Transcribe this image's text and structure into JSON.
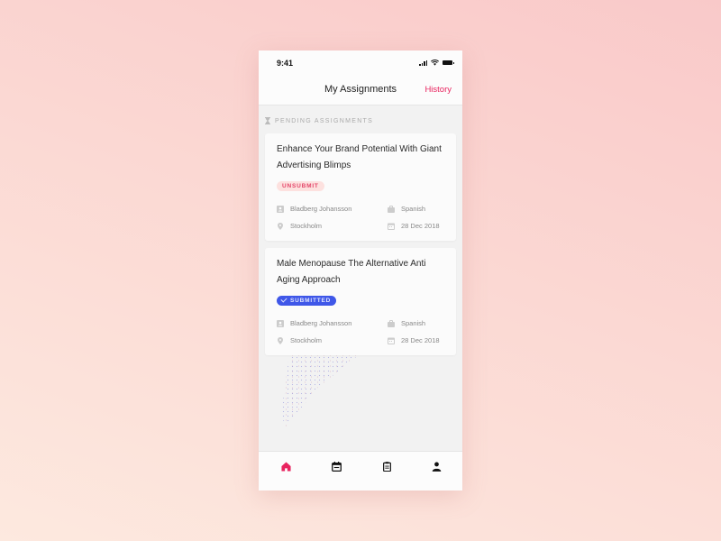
{
  "status_bar": {
    "time": "9:41"
  },
  "header": {
    "title": "My Assignments",
    "history_label": "History"
  },
  "colors": {
    "accent": "#e8245f",
    "submitted": "#3f57e8",
    "unsubmit_bg": "#fde1df",
    "unsubmit_text": "#e4466a"
  },
  "section": {
    "label": "PENDING ASSIGNMENTS",
    "icon": "hourglass-icon"
  },
  "assignments": [
    {
      "title": "Enhance Your Brand Potential With Giant Advertising Blimps",
      "status": "UNSUBMIT",
      "person": "Bladberg Johansson",
      "language": "Spanish",
      "city": "Stockholm",
      "date": "28 Dec 2018"
    },
    {
      "title": "Male Menopause The Alternative Anti Aging Approach",
      "status": "SUBMITTED",
      "person": "Bladberg Johansson",
      "language": "Spanish",
      "city": "Stockholm",
      "date": "28 Dec 2018"
    }
  ],
  "tabbar": {
    "items": [
      {
        "icon": "home-icon",
        "active": true
      },
      {
        "icon": "calendar-icon",
        "active": false
      },
      {
        "icon": "clipboard-icon",
        "active": false
      },
      {
        "icon": "person-icon",
        "active": false
      }
    ]
  }
}
